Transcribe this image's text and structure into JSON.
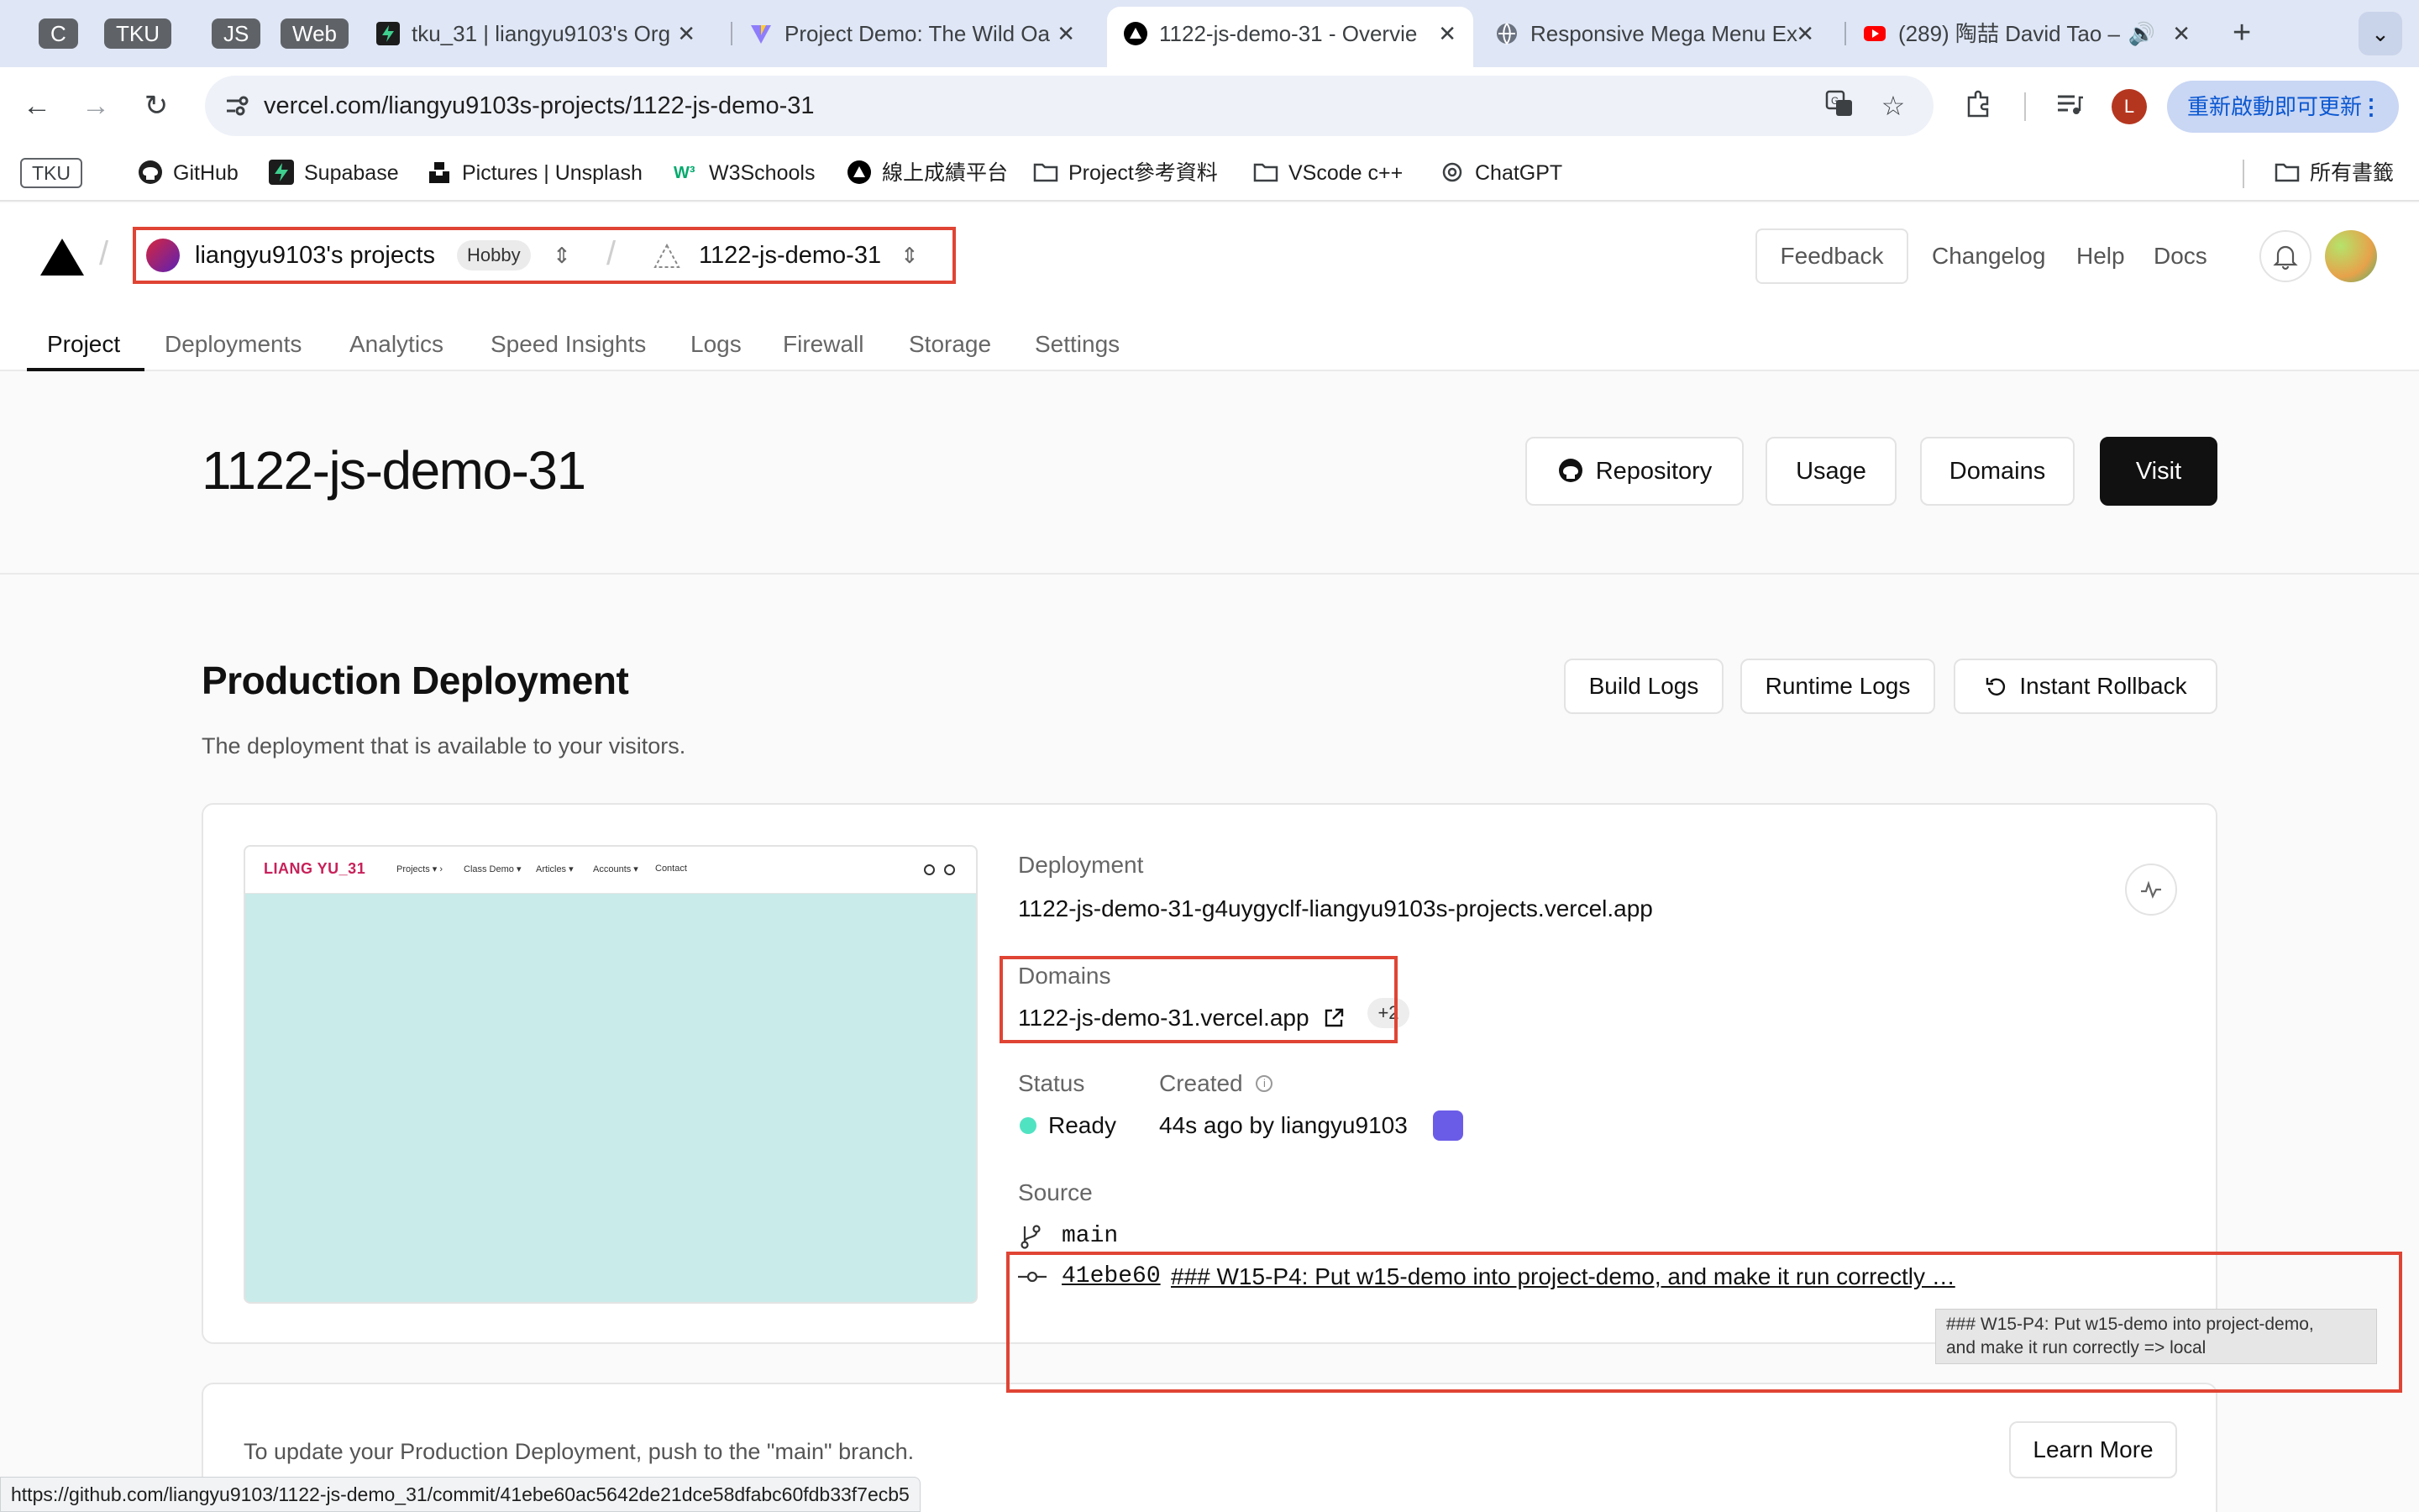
{
  "browser": {
    "tab_groups": [
      "C",
      "TKU",
      "JS",
      "Web"
    ],
    "tabs": [
      {
        "title": "tku_31 | liangyu9103's Org",
        "active": false
      },
      {
        "title": "Project Demo: The Wild Oa",
        "active": false
      },
      {
        "title": "1122-js-demo-31 - Overvie",
        "active": true
      },
      {
        "title": "Responsive Mega Menu Ex",
        "active": false
      },
      {
        "title": "(289) 陶喆 David Tao –",
        "active": false
      }
    ],
    "url": "vercel.com/liangyu9103s-projects/1122-js-demo-31",
    "profile_initial": "L",
    "update_label": "重新啟動即可更新",
    "bookmarks": [
      {
        "label": "TKU"
      },
      {
        "label": "GitHub"
      },
      {
        "label": "Supabase"
      },
      {
        "label": "Pictures | Unsplash"
      },
      {
        "label": "W3Schools"
      },
      {
        "label": "線上成績平台"
      },
      {
        "label": "Project參考資料"
      },
      {
        "label": "VScode c++"
      },
      {
        "label": "ChatGPT"
      }
    ],
    "all_bookmarks_label": "所有書籤",
    "status_url": "https://github.com/liangyu9103/1122-js-demo_31/commit/41ebe60ac5642de21dce58dfabc60fdb33f7ecb5"
  },
  "header": {
    "team_name": "liangyu9103's projects",
    "plan_badge": "Hobby",
    "project_name": "1122-js-demo-31",
    "feedback_label": "Feedback",
    "links": [
      "Changelog",
      "Help",
      "Docs"
    ],
    "tabs": [
      "Project",
      "Deployments",
      "Analytics",
      "Speed Insights",
      "Logs",
      "Firewall",
      "Storage",
      "Settings"
    ]
  },
  "hero": {
    "title": "1122-js-demo-31",
    "buttons": {
      "repository": "Repository",
      "usage": "Usage",
      "domains": "Domains",
      "visit": "Visit"
    }
  },
  "production": {
    "title": "Production Deployment",
    "subtitle": "The deployment that is available to your visitors.",
    "buttons": {
      "build_logs": "Build Logs",
      "runtime_logs": "Runtime Logs",
      "rollback": "Instant Rollback"
    },
    "preview": {
      "brand": "LIANG YU_31",
      "nav": [
        "Projects ▾ ›",
        "Class Demo ▾",
        "Articles ▾",
        "Accounts ▾",
        "Contact"
      ]
    },
    "deployment_label": "Deployment",
    "deployment_url": "1122-js-demo-31-g4uygyclf-liangyu9103s-projects.vercel.app",
    "domains_label": "Domains",
    "domain": "1122-js-demo-31.vercel.app",
    "extra_domains": "+2",
    "status_label": "Status",
    "status_value": "Ready",
    "created_label": "Created",
    "created_value": "44s ago by liangyu9103",
    "source_label": "Source",
    "branch": "main",
    "commit_hash": "41ebe60",
    "commit_message": "### W15-P4: Put w15-demo into project-demo, and make it run correctly …",
    "tooltip_line1": "### W15-P4: Put w15-demo into project-demo,",
    "tooltip_line2": "and make it run correctly => local",
    "status_color": "#50e3c2"
  },
  "footer_card": {
    "text": "To update your Production Deployment, push to the \"main\" branch.",
    "learn_more": "Learn More"
  }
}
